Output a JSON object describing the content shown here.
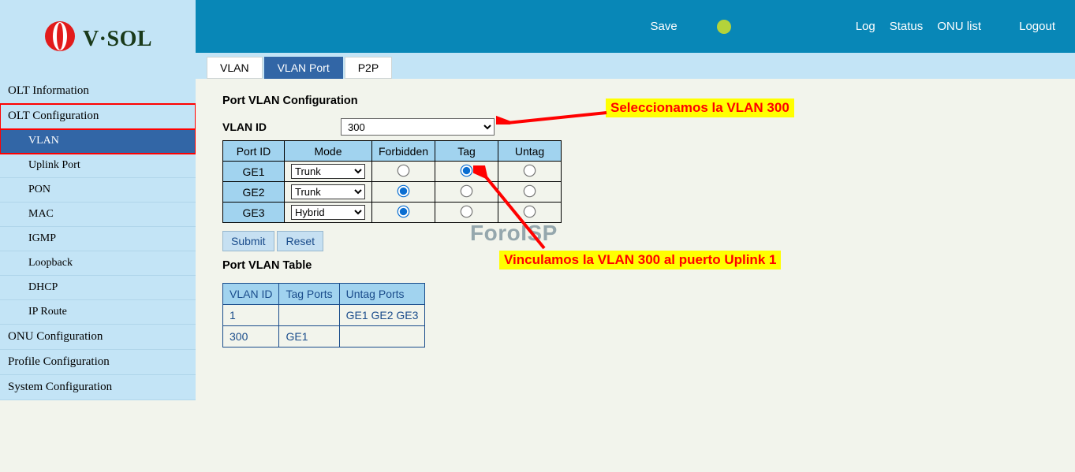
{
  "brand": "V·SOL",
  "topnav": {
    "save": "Save",
    "log": "Log",
    "status": "Status",
    "onulist": "ONU list",
    "logout": "Logout"
  },
  "sidebar": {
    "items": [
      {
        "label": "OLT Information",
        "kind": "top"
      },
      {
        "label": "OLT Configuration",
        "kind": "top",
        "boxed": true
      },
      {
        "label": "VLAN",
        "kind": "sub",
        "active": true,
        "boxed": true
      },
      {
        "label": "Uplink Port",
        "kind": "sub"
      },
      {
        "label": "PON",
        "kind": "sub"
      },
      {
        "label": "MAC",
        "kind": "sub"
      },
      {
        "label": "IGMP",
        "kind": "sub"
      },
      {
        "label": "Loopback",
        "kind": "sub"
      },
      {
        "label": "DHCP",
        "kind": "sub"
      },
      {
        "label": "IP Route",
        "kind": "sub"
      },
      {
        "label": "ONU Configuration",
        "kind": "top"
      },
      {
        "label": "Profile Configuration",
        "kind": "top"
      },
      {
        "label": "System Configuration",
        "kind": "top"
      }
    ]
  },
  "tabs": [
    {
      "label": "VLAN",
      "active": false
    },
    {
      "label": "VLAN Port",
      "active": true
    },
    {
      "label": "P2P",
      "active": false
    }
  ],
  "section1_title": "Port VLAN Configuration",
  "vlan_id_label": "VLAN ID",
  "vlan_id_value": "300",
  "port_headers": [
    "Port ID",
    "Mode",
    "Forbidden",
    "Tag",
    "Untag"
  ],
  "ports": [
    {
      "id": "GE1",
      "mode": "Trunk",
      "sel": "Tag"
    },
    {
      "id": "GE2",
      "mode": "Trunk",
      "sel": "Forbidden"
    },
    {
      "id": "GE3",
      "mode": "Hybrid",
      "sel": "Forbidden"
    }
  ],
  "mode_options": [
    "Trunk",
    "Hybrid"
  ],
  "buttons": {
    "submit": "Submit",
    "reset": "Reset"
  },
  "section2_title": "Port VLAN Table",
  "vlan_table_headers": [
    "VLAN ID",
    "Tag Ports",
    "Untag Ports"
  ],
  "vlan_table_rows": [
    {
      "id": "1",
      "tag": "",
      "untag": "GE1 GE2 GE3"
    },
    {
      "id": "300",
      "tag": "GE1",
      "untag": ""
    }
  ],
  "annot1": "Seleccionamos la VLAN 300",
  "annot2": "Vinculamos la VLAN 300 al puerto Uplink 1",
  "watermark": "ForoISP"
}
